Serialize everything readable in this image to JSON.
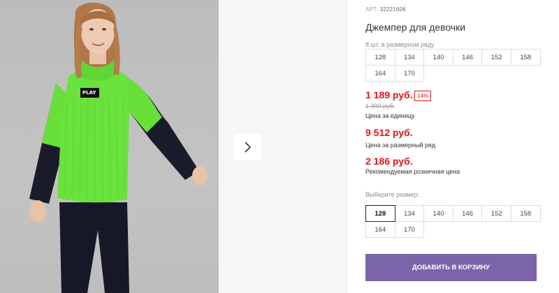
{
  "gallery": {
    "next_icon": "chevron-right-icon",
    "patch_text": "PLAY"
  },
  "product": {
    "article_prefix": "АРТ:",
    "article_number": "32221606",
    "title": "Джемпер для девочки"
  },
  "size_set": {
    "label": "8 шт. в размерном ряду",
    "sizes": [
      "128",
      "134",
      "140",
      "146",
      "152",
      "158",
      "164",
      "170"
    ]
  },
  "prices": {
    "current": "1 189 руб.",
    "discount_badge": "14%",
    "old": "1 390 руб.",
    "unit_caption": "Цена за единицу",
    "set_price": "9 512 руб.",
    "set_caption": "Цена за размерный ряд",
    "retail_price": "2 186 руб.",
    "retail_caption": "Рекомендуемая розничная цена",
    "accent_color": "#e3141a"
  },
  "size_picker": {
    "label": "Выберите размер:",
    "sizes": [
      "128",
      "134",
      "140",
      "146",
      "152",
      "158",
      "164",
      "170"
    ],
    "selected": "128"
  },
  "cart": {
    "button_label": "ДОБАВИТЬ В КОРЗИНУ",
    "button_color": "#7c64aa"
  }
}
